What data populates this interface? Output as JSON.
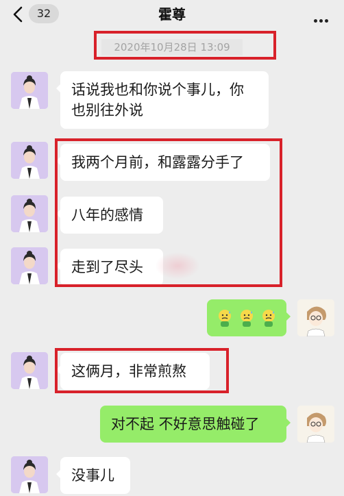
{
  "header": {
    "unread_count": "32",
    "contact_name": "霍尊"
  },
  "timestamp": "2020年10月28日 13:09",
  "messages": [
    {
      "side": "left",
      "text": "话说我也和你说个事儿，你也别往外说"
    },
    {
      "side": "left",
      "text": "我两个月前，和露露分手了"
    },
    {
      "side": "left",
      "text": "八年的感情"
    },
    {
      "side": "left",
      "text": "走到了尽头"
    },
    {
      "side": "right",
      "text": "",
      "emoji": "sweat-emoji ×3"
    },
    {
      "side": "left",
      "text": "这俩月，非常煎熬"
    },
    {
      "side": "right",
      "text": "对不起 不好意思触碰了"
    },
    {
      "side": "left",
      "text": "没事儿"
    }
  ],
  "colors": {
    "background": "#ededed",
    "bubble_incoming": "#ffffff",
    "bubble_outgoing": "#95ec69",
    "highlight_box": "#d8212a"
  }
}
